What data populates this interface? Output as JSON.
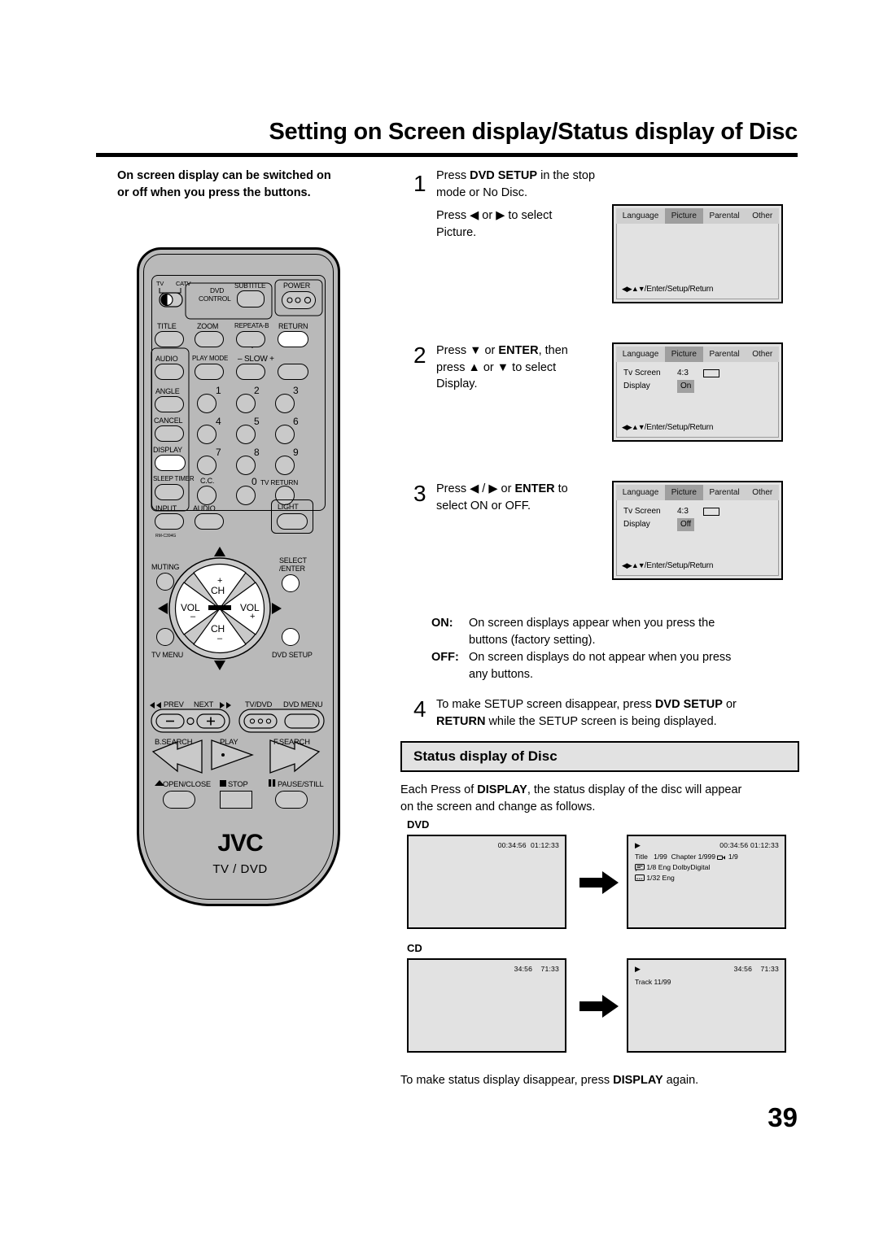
{
  "page": {
    "title": "Setting on Screen display/Status display of Disc",
    "number": "39"
  },
  "left": {
    "intro_line1": "On screen display can be switched on",
    "intro_line2": "or off when you press the buttons.",
    "remote": {
      "model": "RM-C394G",
      "brand": "JVC",
      "brand_sub": "TV / DVD",
      "labels": {
        "tv": "TV",
        "catv": "CATV",
        "dvd_control_1": "DVD",
        "dvd_control_2": "CONTROL",
        "subtitle": "SUBTITLE",
        "power": "POWER",
        "title": "TITLE",
        "zoom": "ZOOM",
        "repeat_ab": "REPEATA-B",
        "return": "RETURN",
        "audio": "AUDIO",
        "play_mode": "PLAY MODE",
        "slow": "– SLOW +",
        "angle": "ANGLE",
        "cancel": "CANCEL",
        "display": "DISPLAY",
        "sleep_timer": "SLEEP TIMER",
        "cc": "C.C.",
        "tv_return": "TV RETURN",
        "input": "INPUT",
        "audio2": "AUDIO",
        "light": "LIGHT",
        "muting": "MUTING",
        "select_enter_1": "SELECT",
        "select_enter_2": "/ENTER",
        "ch_up_plus": "+",
        "ch_up": "CH",
        "ch_dn": "CH",
        "ch_dn_minus": "–",
        "vol_left": "VOL",
        "vol_left_minus": "–",
        "vol_right": "VOL",
        "vol_right_plus": "+",
        "tv_menu": "TV MENU",
        "dvd_setup": "DVD SETUP",
        "prev": "PREV",
        "next": "NEXT",
        "tv_dvd": "TV/DVD",
        "dvd_menu": "DVD MENU",
        "b_search": "B.SEARCH",
        "play": "PLAY",
        "f_search": "F.SEARCH",
        "open_close": "OPEN/CLOSE",
        "stop": "STOP",
        "pause_still": "PAUSE/STILL",
        "num_1": "1",
        "num_2": "2",
        "num_3": "3",
        "num_4": "4",
        "num_5": "5",
        "num_6": "6",
        "num_7": "7",
        "num_8": "8",
        "num_9": "9",
        "num_0": "0"
      }
    }
  },
  "steps": [
    {
      "num": "1",
      "line1_a": "Press ",
      "line1_b": "DVD SETUP",
      "line1_c": " in the stop mode or No Disc.",
      "line2": "Press ◀ or ▶ to select",
      "line3": "Picture."
    },
    {
      "num": "2",
      "line1_a": "Press ▼ or ",
      "line1_b": "ENTER",
      "line1_c": ", then",
      "line2": "press ▲ or ▼ to select",
      "line3": "Display."
    },
    {
      "num": "3",
      "line1_a": "Press ◀ / ▶ or ",
      "line1_b": "ENTER",
      "line1_c": " to",
      "line2": "select ON or OFF.",
      "line3": ""
    },
    {
      "num": "4",
      "line1_a": "To make SETUP screen disappear, press ",
      "line1_b": "DVD SETUP",
      "line1_c": " or",
      "line2_b": "RETURN",
      "line2_c": " while the SETUP screen is being displayed."
    }
  ],
  "osd": {
    "tabs": [
      "Language",
      "Picture",
      "Parental",
      "Other"
    ],
    "selected_tab": "Picture",
    "footer": "/Enter/Setup/Return",
    "footer_arrows": "◀▶▲▼",
    "rows": {
      "tv_screen_key": "Tv Screen",
      "tv_screen_value": "4:3",
      "display_key": "Display",
      "display_on": "On",
      "display_off": "Off"
    }
  },
  "onoff": {
    "on_tag": "ON:",
    "on_line1": "On screen displays appear when you press the",
    "on_line2": "buttons (factory setting).",
    "off_tag": "OFF:",
    "off_line1": "On screen displays do not appear when you press",
    "off_line2": "any buttons."
  },
  "status_section": {
    "heading": "Status display of Disc",
    "intro_a": "Each Press of ",
    "intro_b": "DISPLAY",
    "intro_c": ", the status display of the disc will appear",
    "intro_line2": "on the screen and change as follows.",
    "footer_a": "To make status display disappear, press ",
    "footer_b": "DISPLAY",
    "footer_c": " again."
  },
  "dvd_display": {
    "label": "DVD",
    "screen1": {
      "elapsed": "00:34:56",
      "total": "01:12:33"
    },
    "screen2": {
      "play_icon": "▶",
      "elapsed": "00:34:56",
      "total": "01:12:33",
      "title_key": "Title",
      "title_value": "1/99",
      "chapter_key": "Chapter",
      "chapter_value": "1/999",
      "angle_value": "1/9",
      "audio_value": "1/8",
      "audio_lang": "Eng",
      "audio_format": "DolbyDigital",
      "subtitle_value": "1/32",
      "subtitle_lang": "Eng"
    }
  },
  "cd_display": {
    "label": "CD",
    "screen1": {
      "elapsed": "34:56",
      "total": "71:33"
    },
    "screen2": {
      "play_icon": "▶",
      "elapsed": "34:56",
      "total": "71:33",
      "track": "Track 11/99"
    }
  }
}
